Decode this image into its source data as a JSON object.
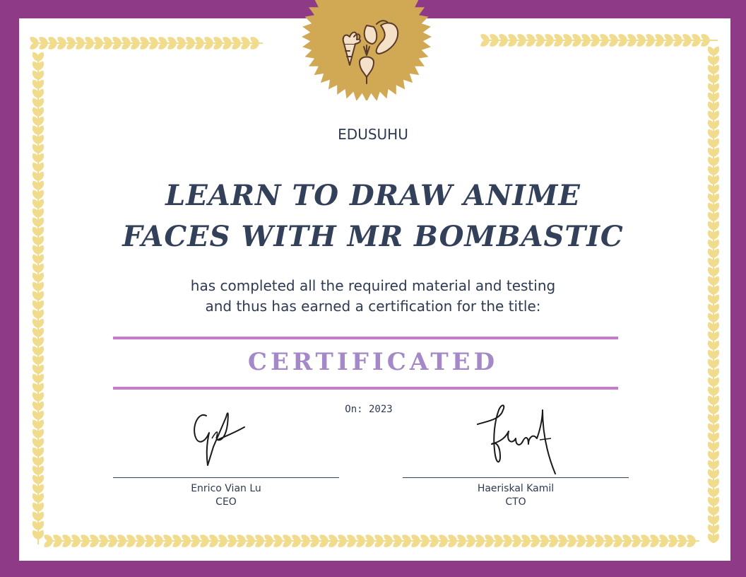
{
  "certificate": {
    "organization": "EDUSUHU",
    "course_title": "LEARN TO DRAW ANIME FACES WITH MR BOMBASTIC",
    "description_line1": "has completed all the required material and testing",
    "description_line2": "and thus has earned a certification for the title:",
    "award_title": "CERTIFICATED",
    "date": "On: 2023"
  },
  "signatories": [
    {
      "name": "Enrico Vian Lu",
      "role": "CEO"
    },
    {
      "name": "Haeriskal Kamil",
      "role": "CTO"
    }
  ],
  "colors": {
    "border": "#8f3a87",
    "paper": "#ffffff",
    "leaf_trim": "#f0dc8c",
    "seal": "#d1a955",
    "rule": "#c77ccb",
    "award_text": "#a488c8",
    "text": "#2e3a52"
  },
  "icons": {
    "seal": "vegetables-seal-icon"
  }
}
